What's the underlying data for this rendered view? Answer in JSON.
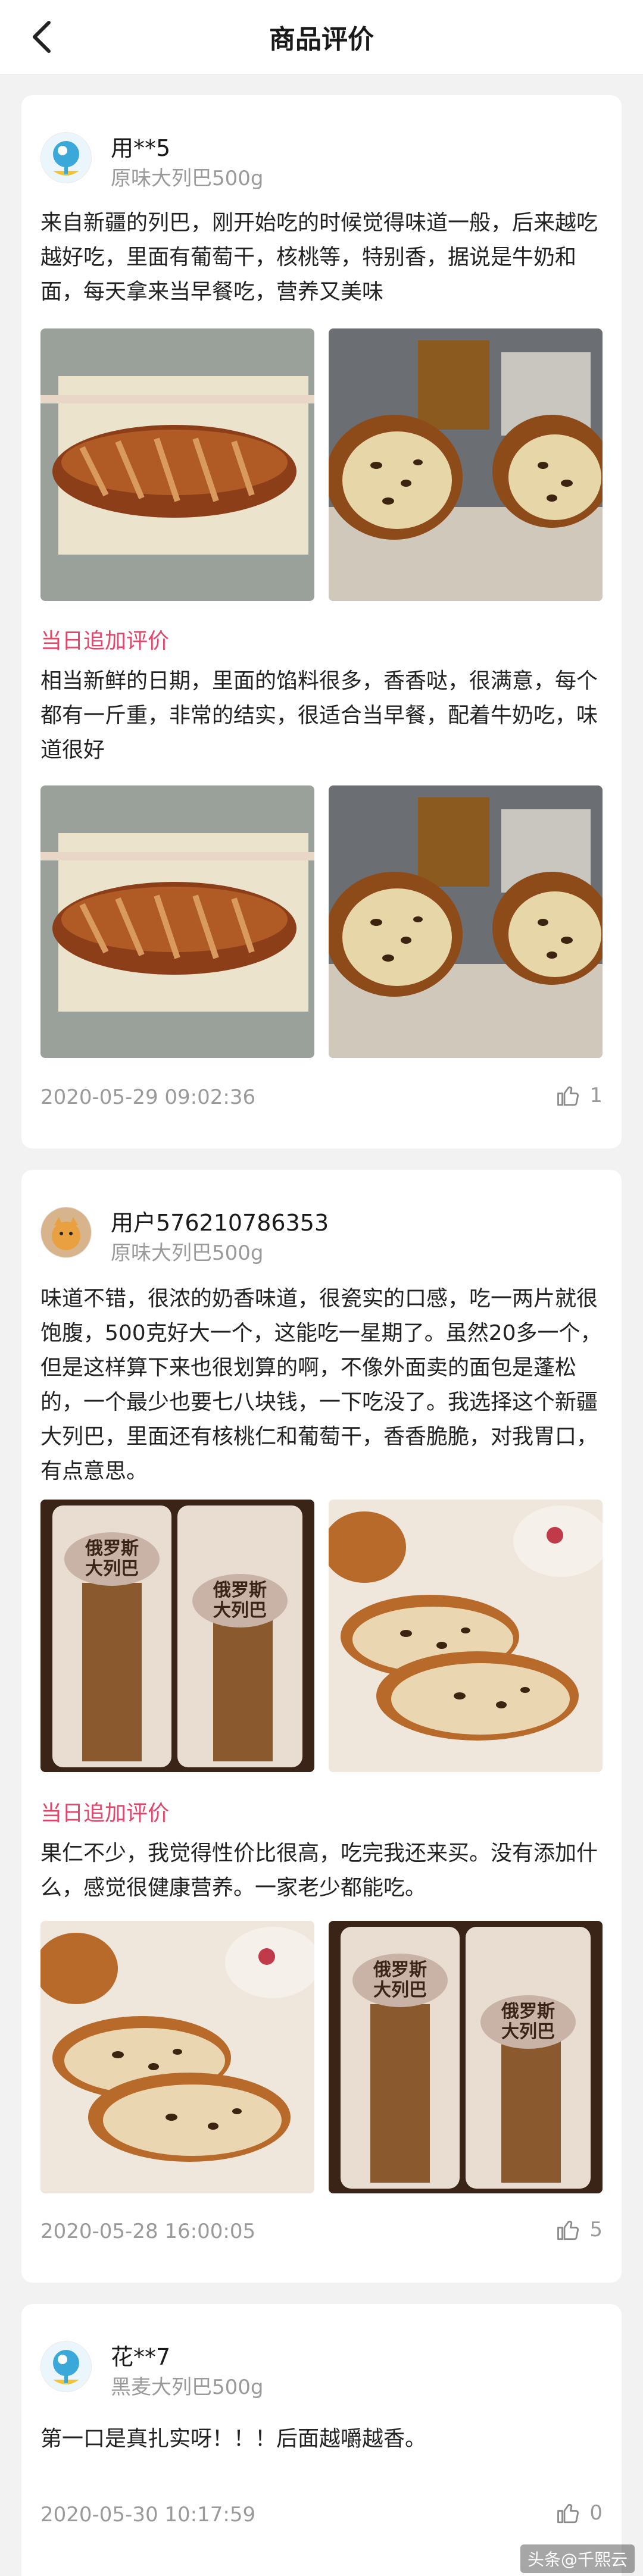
{
  "header": {
    "title": "商品评价"
  },
  "reviews": [
    {
      "user": "用**5",
      "sku": "原味大列巴500g",
      "text": "来自新疆的列巴，刚开始吃的时候觉得味道一般，后来越吃越好吃，里面有葡萄干，核桃等，特别香，据说是牛奶和面，每天拿来当早餐吃，营养又美味",
      "followup_label": "当日追加评价",
      "followup_text": "相当新鲜的日期，里面的馅料很多，香香哒，很满意，每个都有一斤重，非常的结实，很适合当早餐，配着牛奶吃，味道很好",
      "date": "2020-05-29   09:02:36",
      "likes": "1"
    },
    {
      "user": "用户576210786353",
      "sku": "原味大列巴500g",
      "text": "味道不错，很浓的奶香味道，很瓷实的口感，吃一两片就很饱腹，500克好大一个，这能吃一星期了。虽然20多一个，但是这样算下来也很划算的啊，不像外面卖的面包是蓬松的，一个最少也要七八块钱，一下吃没了。我选择这个新疆大列巴，里面还有核桃仁和葡萄干，香香脆脆，对我胃口，有点意思。",
      "followup_label": "当日追加评价",
      "followup_text": "果仁不少，我觉得性价比很高，吃完我还来买。没有添加什么，感觉很健康营养。一家老少都能吃。",
      "date": "2020-05-28   16:00:05",
      "likes": "5",
      "package_text": "俄罗斯\n大列巴"
    },
    {
      "user": "花**7",
      "sku": "黑麦大列巴500g",
      "text": "第一口是真扎实呀！！！后面越嚼越香。",
      "date": "2020-05-30   10:17:59",
      "likes": "0"
    }
  ],
  "watermark": "头条@千熙云",
  "colors": {
    "accent": "#e2466a",
    "muted": "#9a9a9a",
    "background": "#f2f2f2"
  },
  "icons": {
    "back": "chevron-left-icon",
    "like": "thumbs-up-icon"
  }
}
